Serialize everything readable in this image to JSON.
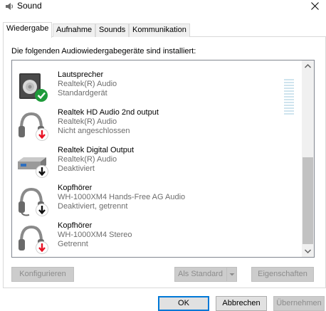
{
  "window": {
    "title": "Sound",
    "icon": "speaker-icon",
    "close_icon": "close-icon"
  },
  "tabs": [
    {
      "label": "Wiedergabe",
      "active": true
    },
    {
      "label": "Aufnahme",
      "active": false
    },
    {
      "label": "Sounds",
      "active": false
    },
    {
      "label": "Kommunikation",
      "active": false
    }
  ],
  "intro_text": "Die folgenden Audiowiedergabegeräte sind installiert:",
  "devices": [
    {
      "name": "Lautsprecher",
      "driver": "Realtek(R) Audio",
      "status": "Standardgerät",
      "icon": "speaker-device-icon",
      "badge": "green-check-icon"
    },
    {
      "name": "Realtek HD Audio 2nd output",
      "driver": "Realtek(R) Audio",
      "status": "Nicht angeschlossen",
      "icon": "headphones-icon",
      "badge": "red-down-arrow-icon"
    },
    {
      "name": "Realtek Digital Output",
      "driver": "Realtek(R) Audio",
      "status": "Deaktiviert",
      "icon": "digital-output-icon",
      "badge": "black-down-arrow-icon"
    },
    {
      "name": "Kopfhörer",
      "driver": "WH-1000XM4 Hands-Free AG Audio",
      "status": "Deaktiviert, getrennt",
      "icon": "headset-icon",
      "badge": "black-down-arrow-icon"
    },
    {
      "name": "Kopfhörer",
      "driver": "WH-1000XM4 Stereo",
      "status": "Getrennt",
      "icon": "headphones-icon",
      "badge": "red-down-arrow-icon"
    }
  ],
  "buttons": {
    "configure": "Konfigurieren",
    "set_default": "Als Standard",
    "properties": "Eigenschaften",
    "ok": "OK",
    "cancel": "Abbrechen",
    "apply": "Übernehmen"
  },
  "colors": {
    "accent": "#0078d7",
    "check_green": "#1e9b3a",
    "arrow_red": "#e81123"
  }
}
